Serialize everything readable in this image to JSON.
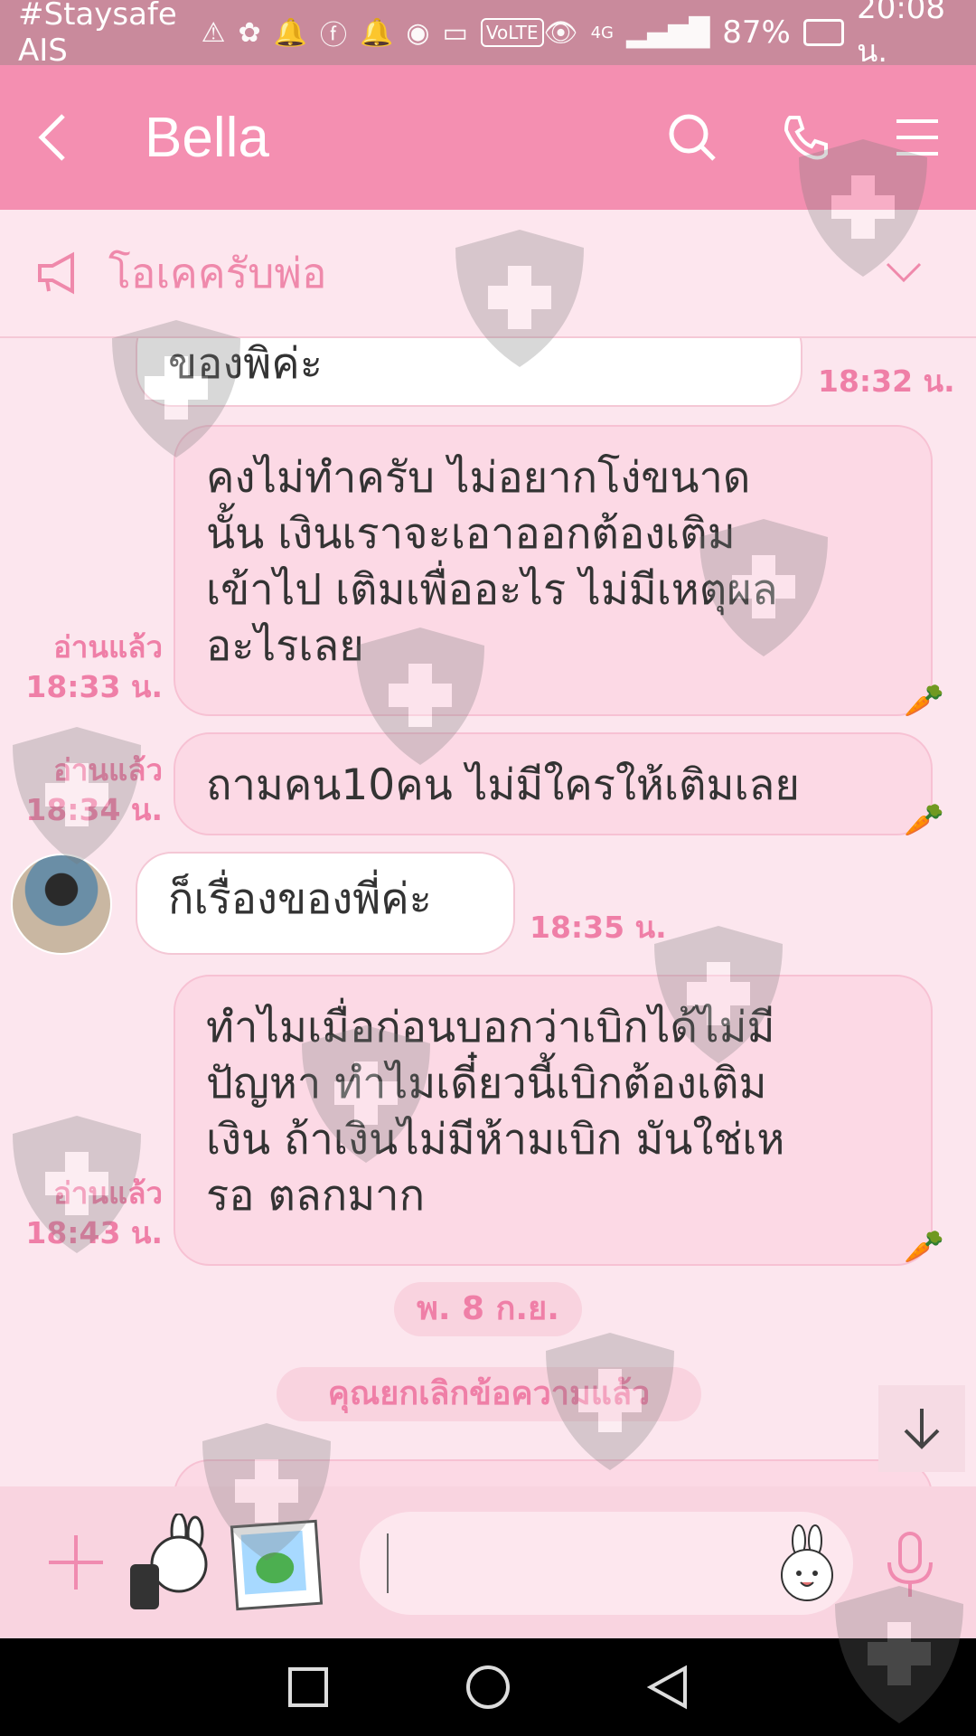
{
  "status_bar": {
    "carrier": "#Staysafe AIS",
    "battery": "87%",
    "time": "20:08 น.",
    "icons": [
      "warning-icon",
      "app-icon",
      "bell-icon",
      "facebook-icon",
      "bell-icon",
      "hotspot-icon",
      "cast-icon",
      "volte-badge",
      "eye-icon",
      "signal-icon",
      "battery-icon"
    ],
    "volte_label": "VoLTE",
    "network_label": "4G"
  },
  "header": {
    "title": "Bella",
    "icons": [
      "back-icon",
      "search-icon",
      "phone-icon",
      "menu-icon"
    ]
  },
  "notice": {
    "text": "โอเคครับพ่อ",
    "icons": [
      "megaphone-icon",
      "chevron-down-icon"
    ]
  },
  "messages": [
    {
      "id": "m0",
      "direction": "in",
      "text": "ของพิค่ะ",
      "time": "18:32 น."
    },
    {
      "id": "m1",
      "direction": "out",
      "lines": [
        "คงไม่ทำครับ ไม่อยากโง่ขนาด",
        "นั้น เงินเราจะเอาออกต้องเติม",
        "เข้าไป เติมเพื่ออะไร ไม่มีเหตุผล",
        "อะไรเลย"
      ],
      "read": "อ่านแล้ว",
      "time": "18:33 น."
    },
    {
      "id": "m2",
      "direction": "out",
      "text": "ถามคน10คน ไม่มีใครให้เติมเลย",
      "read": "อ่านแล้ว",
      "time": "18:34 น."
    },
    {
      "id": "m3",
      "direction": "in",
      "text": "ก็เรื่องของพี่ค่ะ",
      "time": "18:35 น."
    },
    {
      "id": "m4",
      "direction": "out",
      "lines": [
        "ทำไมเมื่อก่อนบอกว่าเบิกได้ไม่มี",
        "ปัญหา ทำไมเดี๋ยวนี้เบิกต้องเติม",
        "เงิน ถ้าเงินไม่มีห้ามเบิก มันใช่เห",
        "รอ ตลกมาก"
      ],
      "read": "อ่านแล้ว",
      "time": "18:43 น."
    }
  ],
  "date_chip": "พ. 8 ก.ย.",
  "system_chip": "คุณยกเลิกข้อความแล้ว",
  "input": {
    "placeholder": "",
    "icons": [
      "plus-icon",
      "sticker-icon",
      "image-icon",
      "emoji-icon",
      "mic-icon"
    ]
  },
  "nav": {
    "icons": [
      "recent-apps-icon",
      "home-icon",
      "back-triangle-icon"
    ]
  },
  "colors": {
    "header_pink": "#f48fb1",
    "status_bar": "#c98a9c",
    "chat_bg": "#fce6ee",
    "accent_text": "#ef7fa7",
    "bubble_out": "#fcd9e5",
    "bubble_in": "#ffffff"
  }
}
